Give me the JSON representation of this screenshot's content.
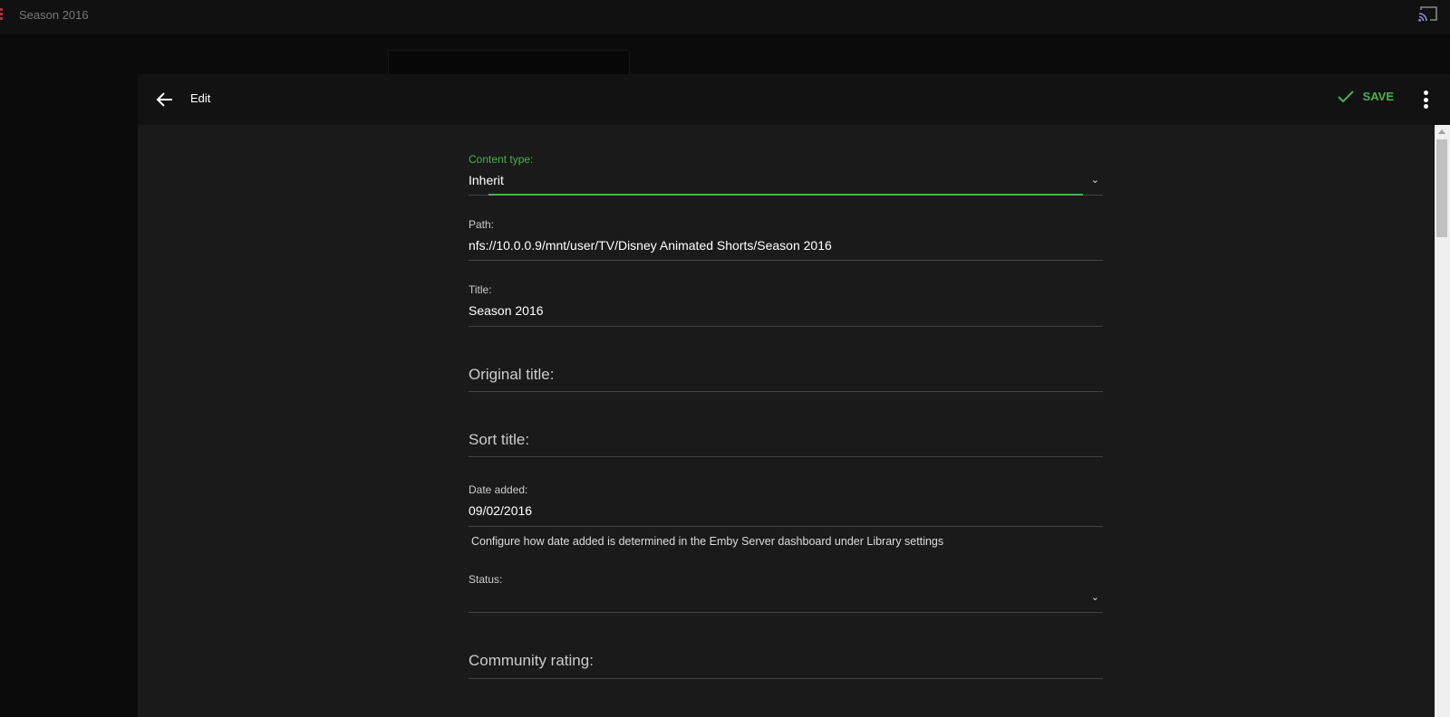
{
  "topbar": {
    "title": "Season 2016",
    "cast_icon": "cast-icon"
  },
  "dialog": {
    "title": "Edit",
    "save_label": "SAVE"
  },
  "form": {
    "content_type": {
      "label": "Content type:",
      "value": "Inherit"
    },
    "path": {
      "label": "Path:",
      "value": "nfs://10.0.0.9/mnt/user/TV/Disney Animated Shorts/Season 2016"
    },
    "title": {
      "label": "Title:",
      "value": "Season 2016"
    },
    "original_title": {
      "label": "Original title:"
    },
    "sort_title": {
      "label": "Sort title:"
    },
    "date_added": {
      "label": "Date added:",
      "value": "09/02/2016",
      "help": "Configure how date added is determined in the Emby Server dashboard under Library settings"
    },
    "status": {
      "label": "Status:",
      "value": ""
    },
    "community_rating": {
      "label": "Community rating:"
    }
  },
  "colors": {
    "accent": "#4caf50",
    "background": "#1a1a1a"
  }
}
